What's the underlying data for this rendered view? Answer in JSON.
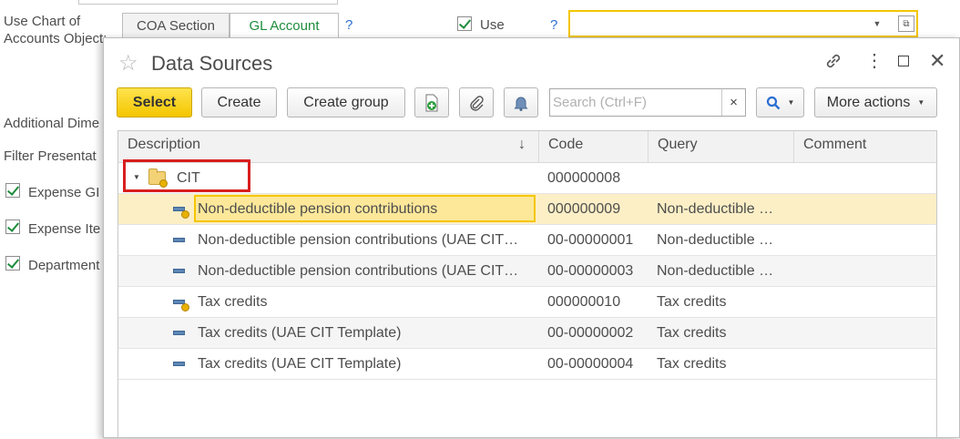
{
  "background": {
    "coa_label_line1": "Use Chart of",
    "coa_label_line2": "Accounts Object:",
    "seg_coa_section": "COA Section",
    "seg_gl_account": "GL Account",
    "help_q": "?",
    "use_label": "Use",
    "help_q2": "?",
    "additional_dims": "Additional Dime",
    "filter_presentation": "Filter Presentat",
    "check_items": [
      "Expense GI",
      "Expense Ite",
      "Department"
    ]
  },
  "dialog": {
    "title": "Data Sources",
    "toolbar": {
      "select": "Select",
      "create": "Create",
      "create_group": "Create group",
      "search_placeholder": "Search (Ctrl+F)",
      "clear": "×",
      "more_actions": "More actions"
    },
    "columns": {
      "description": "Description",
      "sort_arrow": "↓",
      "code": "Code",
      "query": "Query",
      "comment": "Comment"
    },
    "group": {
      "name": "CIT",
      "code": "000000008"
    },
    "rows": [
      {
        "description": "Non-deductible pension contributions",
        "code": "000000009",
        "query": "Non-deductible …",
        "comment": ""
      },
      {
        "description": "Non-deductible pension contributions (UAE CIT…",
        "code": "00-00000001",
        "query": "Non-deductible …",
        "comment": ""
      },
      {
        "description": "Non-deductible pension contributions (UAE CIT…",
        "code": "00-00000003",
        "query": "Non-deductible …",
        "comment": ""
      },
      {
        "description": "Tax credits",
        "code": "000000010",
        "query": "Tax credits",
        "comment": ""
      },
      {
        "description": "Tax credits (UAE CIT Template)",
        "code": "00-00000002",
        "query": "Tax credits",
        "comment": ""
      },
      {
        "description": "Tax credits (UAE CIT Template)",
        "code": "00-00000004",
        "query": "Tax credits",
        "comment": ""
      }
    ]
  },
  "colors": {
    "accent_yellow": "#f4c600",
    "selected_row": "#fcefc6",
    "highlight_red": "#d81e1e",
    "help_blue": "#2b6ed2"
  }
}
